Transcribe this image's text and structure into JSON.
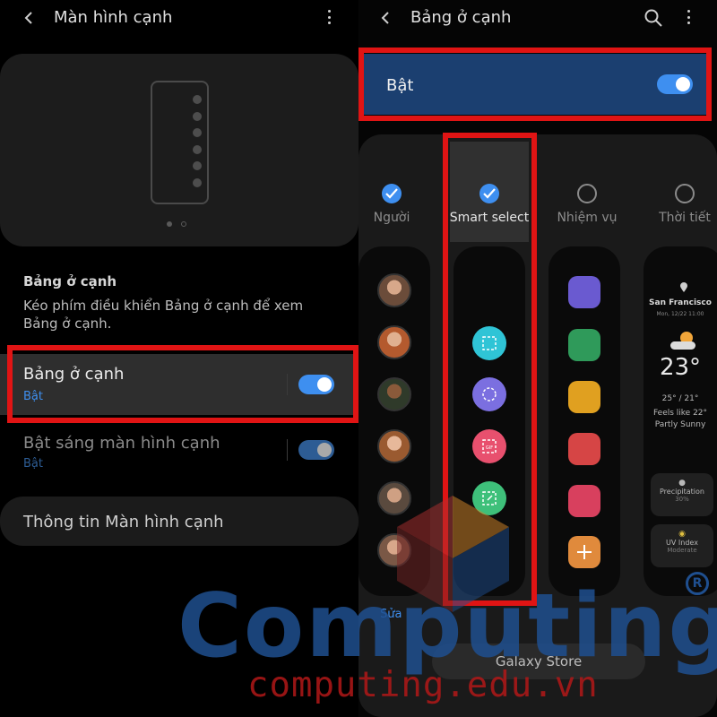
{
  "left": {
    "title": "Màn hình cạnh",
    "section_heading": "Bảng ở cạnh",
    "section_description": "Kéo phím điều khiển Bảng ở cạnh để xem Bảng ở cạnh.",
    "rows": {
      "edge_panels": {
        "label": "Bảng ở cạnh",
        "status": "Bật",
        "toggle_on": true
      },
      "edge_lighting": {
        "label": "Bật sáng màn hình cạnh",
        "status": "Bật",
        "toggle_on": true,
        "enabled": false
      },
      "about": {
        "label": "Thông tin Màn hình cạnh"
      }
    }
  },
  "right": {
    "title": "Bảng ở cạnh",
    "master_toggle": {
      "label": "Bật",
      "on": true
    },
    "panels": [
      {
        "name": "Người",
        "checked": true
      },
      {
        "name": "Smart select",
        "checked": true,
        "selected": true
      },
      {
        "name": "Nhiệm vụ",
        "checked": false
      },
      {
        "name": "Thời tiết",
        "checked": false
      }
    ],
    "weather": {
      "city": "San Francisco",
      "date": "Mon, 12/22 11:00",
      "temperature": "23°",
      "range": "25° / 21°",
      "feels_like": "Feels like 22°",
      "condition": "Partly Sunny",
      "precipitation_label": "Precipitation",
      "precipitation_value": "30%",
      "uv_label": "UV Index",
      "uv_value": "Moderate"
    },
    "edit_link": "Sửa",
    "store_button": "Galaxy Store"
  },
  "watermark": {
    "brand": "Computing",
    "url": "computing.edu.vn",
    "registered": "R"
  },
  "colors": {
    "accent": "#3e8ff0",
    "highlight_border": "#e01414",
    "master_row_bg": "#1b3f70"
  }
}
